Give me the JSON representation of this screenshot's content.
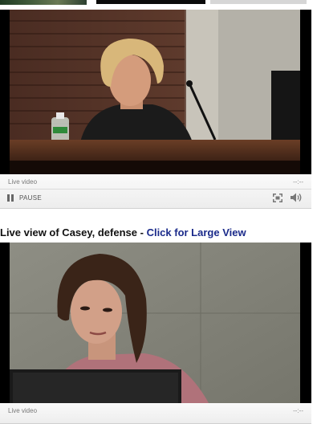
{
  "player1": {
    "status_label": "Live video",
    "time": "--:--",
    "pause_label": "PAUSE"
  },
  "section": {
    "title": "Live view of Casey, defense - ",
    "link_text": "Click for Large View"
  },
  "player2": {
    "status_label": "Live video",
    "time": "--:--"
  }
}
